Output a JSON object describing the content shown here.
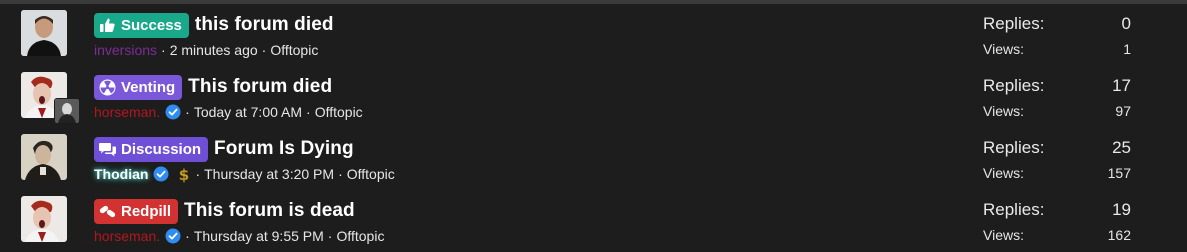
{
  "threads": [
    {
      "prefix": {
        "label": "Success",
        "color": "#19a88a",
        "icon": "thumbs-up-icon"
      },
      "title": "this forum died",
      "author": "inversions",
      "time": "2 minutes ago",
      "forum": "Offtopic",
      "replies_label": "Replies:",
      "replies": "0",
      "views_label": "Views:",
      "views": "1"
    },
    {
      "prefix": {
        "label": "Venting",
        "color": "#7a58d9",
        "icon": "radiation-icon"
      },
      "title": "This forum died",
      "author": "horseman.",
      "time": "Today at 7:00 AM",
      "forum": "Offtopic",
      "replies_label": "Replies:",
      "replies": "17",
      "views_label": "Views:",
      "views": "97"
    },
    {
      "prefix": {
        "label": "Discussion",
        "color": "#6f4fd6",
        "icon": "chat-bubbles-icon"
      },
      "title": "Forum Is Dying",
      "author": "Thodian",
      "time": "Thursday at 3:20 PM",
      "forum": "Offtopic",
      "replies_label": "Replies:",
      "replies": "25",
      "views_label": "Views:",
      "views": "157"
    },
    {
      "prefix": {
        "label": "Redpill",
        "color": "#d23232",
        "icon": "pills-icon"
      },
      "title": "This forum is dead",
      "author": "horseman.",
      "time": "Thursday at 9:55 PM",
      "forum": "Offtopic",
      "replies_label": "Replies:",
      "replies": "19",
      "views_label": "Views:",
      "views": "162"
    }
  ],
  "separator": "·"
}
